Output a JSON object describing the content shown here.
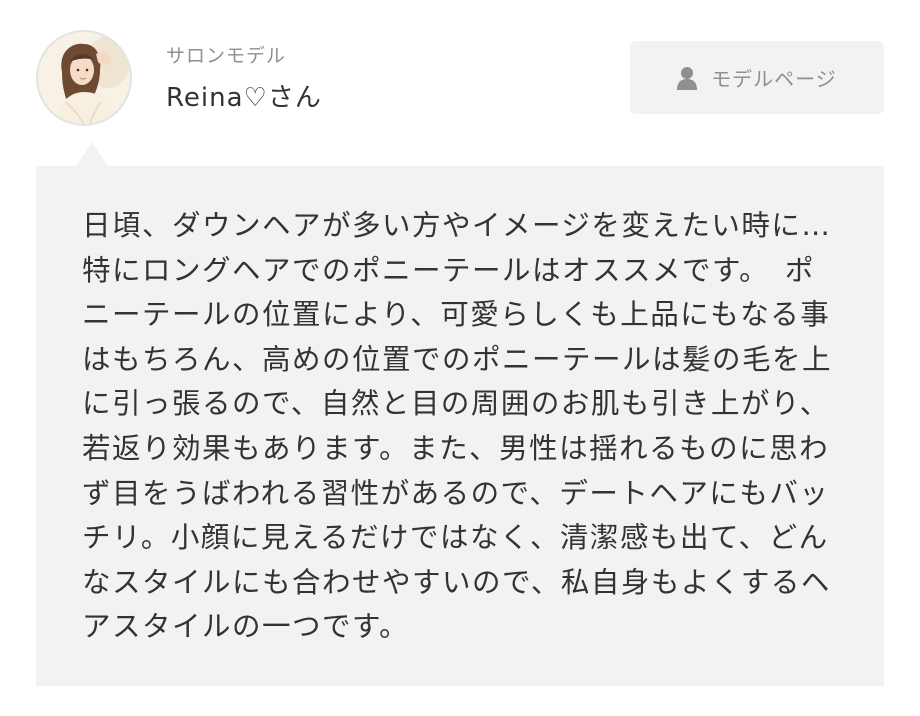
{
  "header": {
    "avatar_icon": "model-portrait-photo",
    "role_label": "サロンモデル",
    "model_name": "Reina♡さん",
    "model_page_button": {
      "icon": "person-icon",
      "label": "モデルページ"
    }
  },
  "comment": {
    "text": "日頃、ダウンヘアが多い方やイメージを変えたい時に…　特にロングヘアでのポニーテールはオススメです。　ポニーテールの位置により、可愛らしくも上品にもなる事はもちろん、高めの位置でのポニーテールは髪の毛を上に引っ張るので、自然と目の周囲のお肌も引き上がり、若返り効果もあります。また、男性は揺れるものに思わず目をうばわれる習性があるので、デートヘアにもバッチリ。小顔に見えるだけではなく、清潔感も出て、どんなスタイルにも合わせやすいので、私自身もよくするヘアスタイルの一つです。"
  },
  "colors": {
    "panel_background": "#f2f2f3",
    "muted_text": "#8f8f8f",
    "body_text": "#333333"
  }
}
